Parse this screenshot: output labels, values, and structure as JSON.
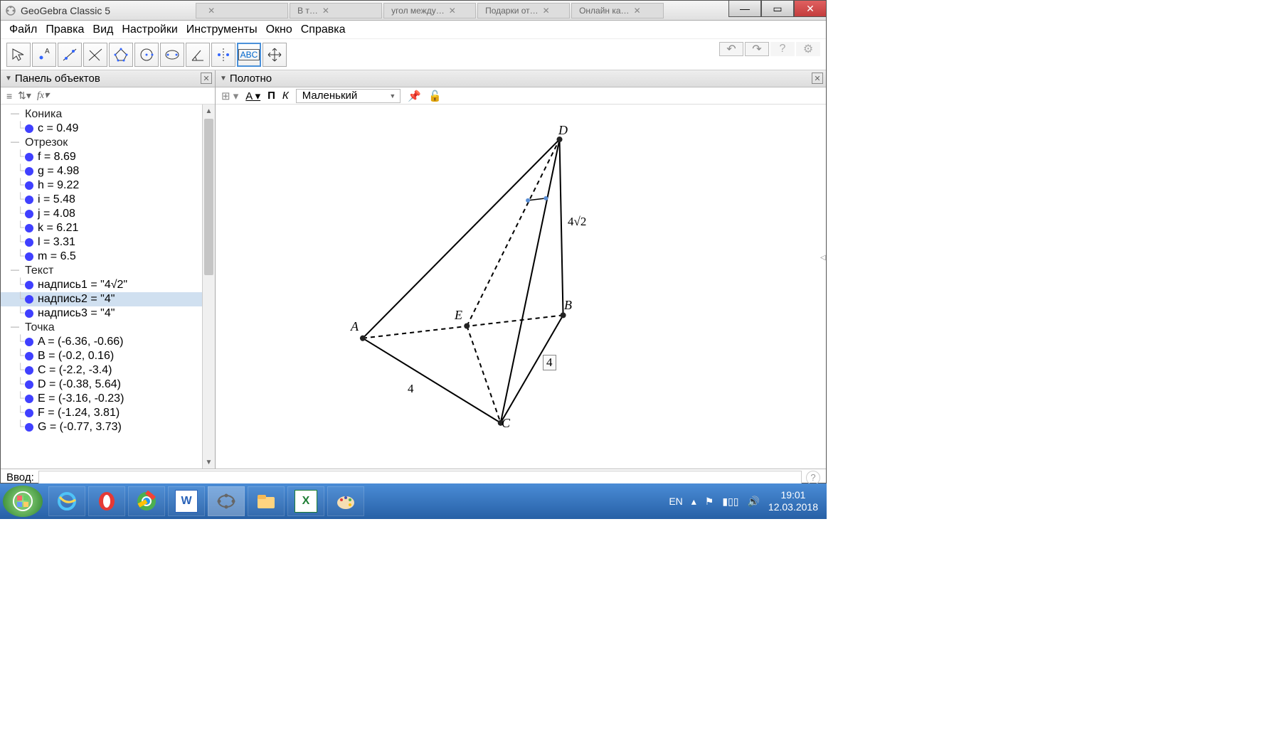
{
  "window": {
    "title": "GeoGebra Classic 5"
  },
  "browser_tabs": [
    {
      "label": "",
      "close": "✕"
    },
    {
      "label": "В т…",
      "close": "✕"
    },
    {
      "label": "угол между…",
      "close": "✕"
    },
    {
      "label": "Подарки от…",
      "close": "✕"
    },
    {
      "label": "Онлайн ка…",
      "close": "✕"
    }
  ],
  "menu": [
    "Файл",
    "Правка",
    "Вид",
    "Настройки",
    "Инструменты",
    "Окно",
    "Справка"
  ],
  "panels": {
    "objects": "Панель объектов",
    "canvas": "Полотно"
  },
  "tree": {
    "konika": "Коника",
    "c": "c = 0.49",
    "otrezok": "Отрезок",
    "f": "f = 8.69",
    "g": "g = 4.98",
    "h": "h = 9.22",
    "i": "i = 5.48",
    "j": "j = 4.08",
    "k": "k = 6.21",
    "l": "l = 3.31",
    "m": "m = 6.5",
    "tekst": "Текст",
    "t1": "надпись1 = \"4√2\"",
    "t2": "надпись2 = \"4\"",
    "t3": "надпись3 = \"4\"",
    "tochka": "Точка",
    "A": "A = (-6.36, -0.66)",
    "B": "B = (-0.2, 0.16)",
    "C": "C = (-2.2, -3.4)",
    "D": "D = (-0.38, 5.64)",
    "E": "E = (-3.16, -0.23)",
    "F": "F = (-1.24, 3.81)",
    "G": "G = (-0.77, 3.73)"
  },
  "canvas_toolbar": {
    "P": "П",
    "K": "К",
    "size": "Маленький"
  },
  "labels": {
    "A": "A",
    "B": "B",
    "C": "C",
    "D": "D",
    "E": "E",
    "edgeDC": "4√2",
    "edgeAC": "4",
    "edgeBC": "4"
  },
  "input": {
    "label": "Ввод:",
    "value": ""
  },
  "tray": {
    "lang": "EN",
    "time": "19:01",
    "date": "12.03.2018"
  }
}
